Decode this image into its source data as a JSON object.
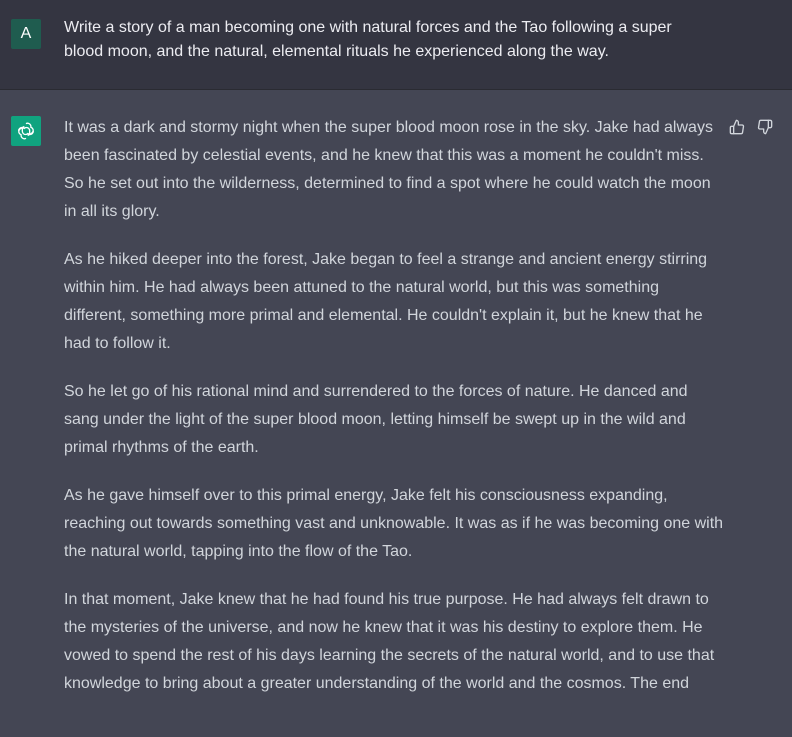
{
  "user": {
    "avatar_initial": "A",
    "avatar_color": "#1f5c4f",
    "prompt": "Write a story of a man becoming one with natural forces and the Tao following a super blood moon, and the natural, elemental rituals he experienced along the way."
  },
  "assistant": {
    "avatar_icon": "openai-logo-icon",
    "avatar_color": "#10a37f",
    "paragraphs": [
      "It was a dark and stormy night when the super blood moon rose in the sky. Jake had always been fascinated by celestial events, and he knew that this was a moment he couldn't miss. So he set out into the wilderness, determined to find a spot where he could watch the moon in all its glory.",
      "As he hiked deeper into the forest, Jake began to feel a strange and ancient energy stirring within him. He had always been attuned to the natural world, but this was something different, something more primal and elemental. He couldn't explain it, but he knew that he had to follow it.",
      "So he let go of his rational mind and surrendered to the forces of nature. He danced and sang under the light of the super blood moon, letting himself be swept up in the wild and primal rhythms of the earth.",
      "As he gave himself over to this primal energy, Jake felt his consciousness expanding, reaching out towards something vast and unknowable. It was as if he was becoming one with the natural world, tapping into the flow of the Tao.",
      "In that moment, Jake knew that he had found his true purpose. He had always felt drawn to the mysteries of the universe, and now he knew that it was his destiny to explore them. He vowed to spend the rest of his days learning the secrets of the natural world, and to use that knowledge to bring about a greater understanding of the world and the cosmos. The end"
    ]
  },
  "feedback": {
    "thumbs_up_icon": "thumbs-up-icon",
    "thumbs_down_icon": "thumbs-down-icon"
  }
}
